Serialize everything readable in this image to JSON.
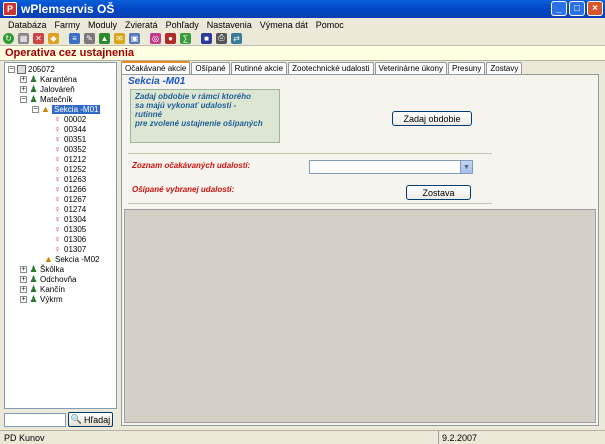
{
  "window": {
    "title": "wPlemservis OŠ"
  },
  "menu": [
    "Databáza",
    "Farmy",
    "Moduly",
    "Zvieratá",
    "Pohľady",
    "Nastavenia",
    "Výmena dát",
    "Pomoc"
  ],
  "header": {
    "title": "Operativa cez ustajnenia"
  },
  "tree": {
    "root": "205072",
    "groups_top": [
      "Karanténa",
      "Jalováreň",
      "Matečník"
    ],
    "selected_section": "Sekcia -M01",
    "animals": [
      "00002",
      "00344",
      "00351",
      "00352",
      "01212",
      "01252",
      "01263",
      "01266",
      "01267",
      "01274",
      "01304",
      "01305",
      "01306",
      "01307"
    ],
    "second_section": "Sekcia -M02",
    "groups_bottom": [
      "Škôlka",
      "Odchovňa",
      "Kančín",
      "Výkrm"
    ]
  },
  "search": {
    "button_label": "Hľadaj"
  },
  "tabs": [
    "Očakávané akcie",
    "Ošípané",
    "Rutinné akcie",
    "Zootechnické udalosti",
    "Veterinárne úkony",
    "Presuny",
    "Zostavy"
  ],
  "panel": {
    "section_title": "Sekcia -M01",
    "info_lines": [
      "Zadaj obdobie v rámci ktorého",
      "sa majú vykonať udalosti -",
      "rutinné",
      "pre zvolené ustajnenie ošípaných"
    ],
    "period_button": "Zadaj obdobie",
    "events_label": "Zoznam očakávaných udalostí:",
    "events_value": "",
    "pigs_label": "Ošípané vybranej udalosti:",
    "report_button": "Zostava"
  },
  "status": {
    "user": "PD Kunov",
    "date": "9.2.2007"
  }
}
